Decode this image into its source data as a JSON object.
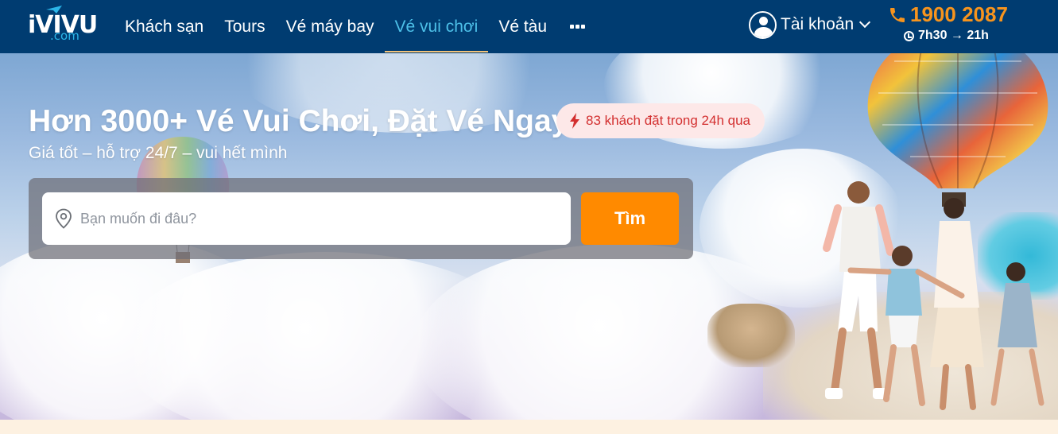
{
  "nav": {
    "logo": {
      "text_main": "iVIVU",
      "text_sub": ".com"
    },
    "items": [
      {
        "label": "Khách sạn",
        "active": false
      },
      {
        "label": "Tours",
        "active": false
      },
      {
        "label": "Vé máy bay",
        "active": false
      },
      {
        "label": "Vé vui chơi",
        "active": true
      },
      {
        "label": "Vé tàu",
        "active": false
      }
    ],
    "more_icon": "more-icon",
    "account": {
      "label": "Tài khoản",
      "icon": "user-icon"
    },
    "hotline": {
      "phone": "1900 2087",
      "hours": "7h30 → 21h"
    }
  },
  "hero": {
    "title": "Hơn 3000+ Vé Vui Chơi, Đặt Vé Ngay",
    "badge": "83 khách đặt trong 24h qua",
    "subtitle": "Giá tốt – hỗ trợ 24/7 – vui hết mình",
    "search": {
      "placeholder": "Bạn muốn đi đâu?",
      "value": "",
      "button_label": "Tìm"
    }
  },
  "colors": {
    "nav_bg": "#003c71",
    "active_link": "#4dc0e8",
    "hotline": "#f7941d",
    "search_button": "#ff8a00",
    "badge_bg": "#fde8e8",
    "badge_text": "#d32f2f",
    "page_bg": "#fdf1e1"
  }
}
